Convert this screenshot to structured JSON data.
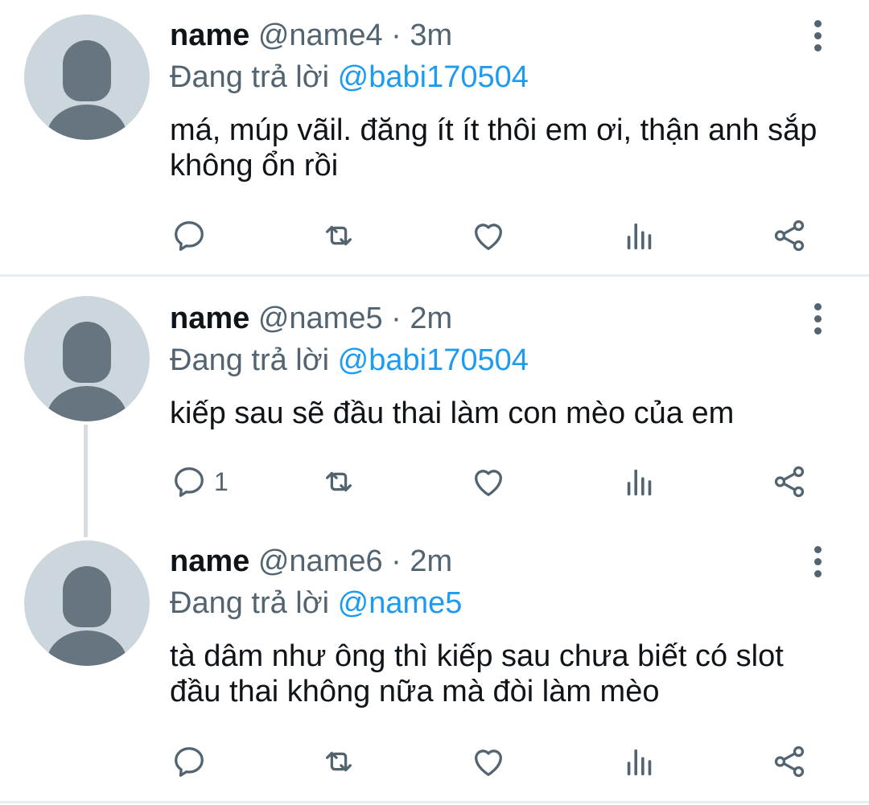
{
  "replying_prefix": "Đang trả lời",
  "tweets": [
    {
      "name": "name",
      "handle": "@name4",
      "time": "· 3m",
      "replying_to": "@babi170504",
      "text": "má, múp vãil. đăng ít ít thôi em ơi, thận anh sắp không ổn rồi",
      "reply_count": ""
    },
    {
      "name": "name",
      "handle": "@name5",
      "time": "· 2m",
      "replying_to": "@babi170504",
      "text": "kiếp sau sẽ đầu thai làm con mèo của em",
      "reply_count": "1"
    },
    {
      "name": "name",
      "handle": "@name6",
      "time": "· 2m",
      "replying_to": "@name5",
      "text": "tà dâm như ông thì kiếp sau chưa biết có slot đầu thai không nữa mà đòi làm mèo",
      "reply_count": ""
    }
  ],
  "colors": {
    "icon": "#536471",
    "mention": "#1d9bf0",
    "avatar_bg": "#ccd6dd",
    "avatar_fg": "#66757f"
  }
}
